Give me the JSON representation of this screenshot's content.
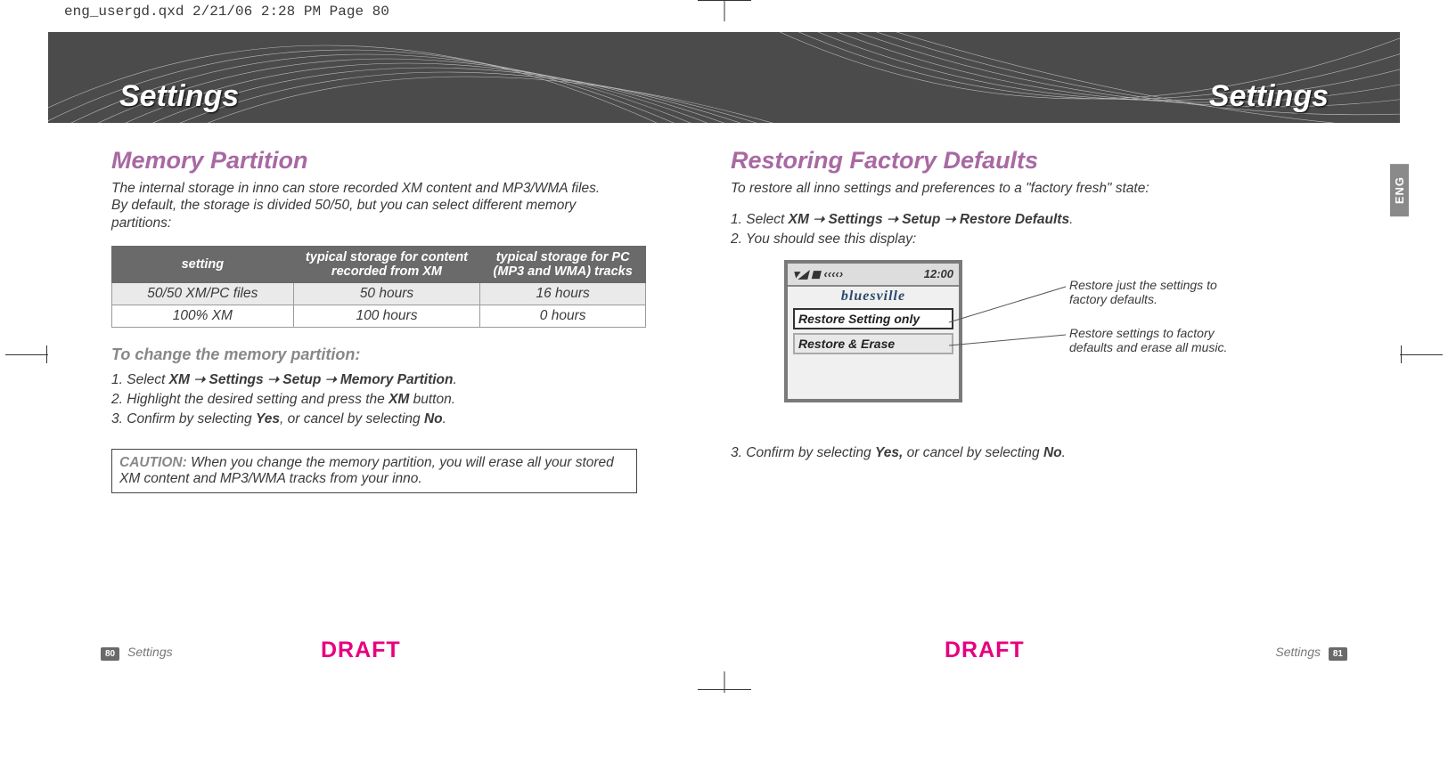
{
  "print_header": "eng_usergd.qxd  2/21/06  2:28 PM  Page 80",
  "banner": {
    "left": "Settings",
    "right": "Settings"
  },
  "side_tab": "ENG",
  "left_page": {
    "heading": "Memory Partition",
    "intro": "The internal storage in inno can store recorded XM content and MP3/WMA files. By default, the storage is divided 50/50, but you can select different memory partitions:",
    "table": {
      "headers": [
        "setting",
        "typical storage for content recorded from XM",
        "typical storage for PC (MP3 and WMA) tracks"
      ],
      "rows": [
        [
          "50/50 XM/PC files",
          "50 hours",
          "16 hours"
        ],
        [
          "100% XM",
          "100 hours",
          "0 hours"
        ]
      ]
    },
    "subhead": "To change the memory partition:",
    "steps": [
      {
        "n": "1.",
        "pre": "Select ",
        "path": "XM ➝ Settings ➝ Setup ➝ Memory Partition",
        "post": "."
      },
      {
        "n": "2.",
        "pre": "Highlight the desired setting and press the ",
        "path": "XM",
        "post": " button."
      },
      {
        "n": "3.",
        "pre": "Confirm by selecting ",
        "path": "Yes",
        "post": ", or cancel by selecting ",
        "path2": "No",
        "post2": "."
      }
    ],
    "caution_label": "CAUTION:",
    "caution": " When you change the memory partition, you will erase all your stored XM content and MP3/WMA tracks from your inno."
  },
  "right_page": {
    "heading": "Restoring Factory Defaults",
    "intro": "To restore all inno settings and preferences to a \"factory fresh\" state:",
    "steps_top": [
      {
        "n": "1.",
        "pre": "Select ",
        "path": "XM ➝ Settings ➝ Setup ➝ Restore Defaults",
        "post": "."
      },
      {
        "n": "2.",
        "text": "You should see this display:"
      }
    ],
    "device": {
      "status_left": "▾◢  ◼  ‹‹‹‹›",
      "status_right": "12:00",
      "brand": "bluesville",
      "item1": "Restore Setting only",
      "item2": "Restore & Erase"
    },
    "callouts": [
      "Restore just the settings to factory defaults.",
      "Restore settings to factory defaults and erase all music."
    ],
    "step3": {
      "n": "3.",
      "pre": "Confirm by selecting ",
      "b1": "Yes,",
      "mid": " or cancel by selecting ",
      "b2": "No",
      "post": "."
    }
  },
  "footer": {
    "left_num": "80",
    "left_label": "Settings",
    "right_label": "Settings",
    "right_num": "81",
    "draft": "DRAFT"
  }
}
